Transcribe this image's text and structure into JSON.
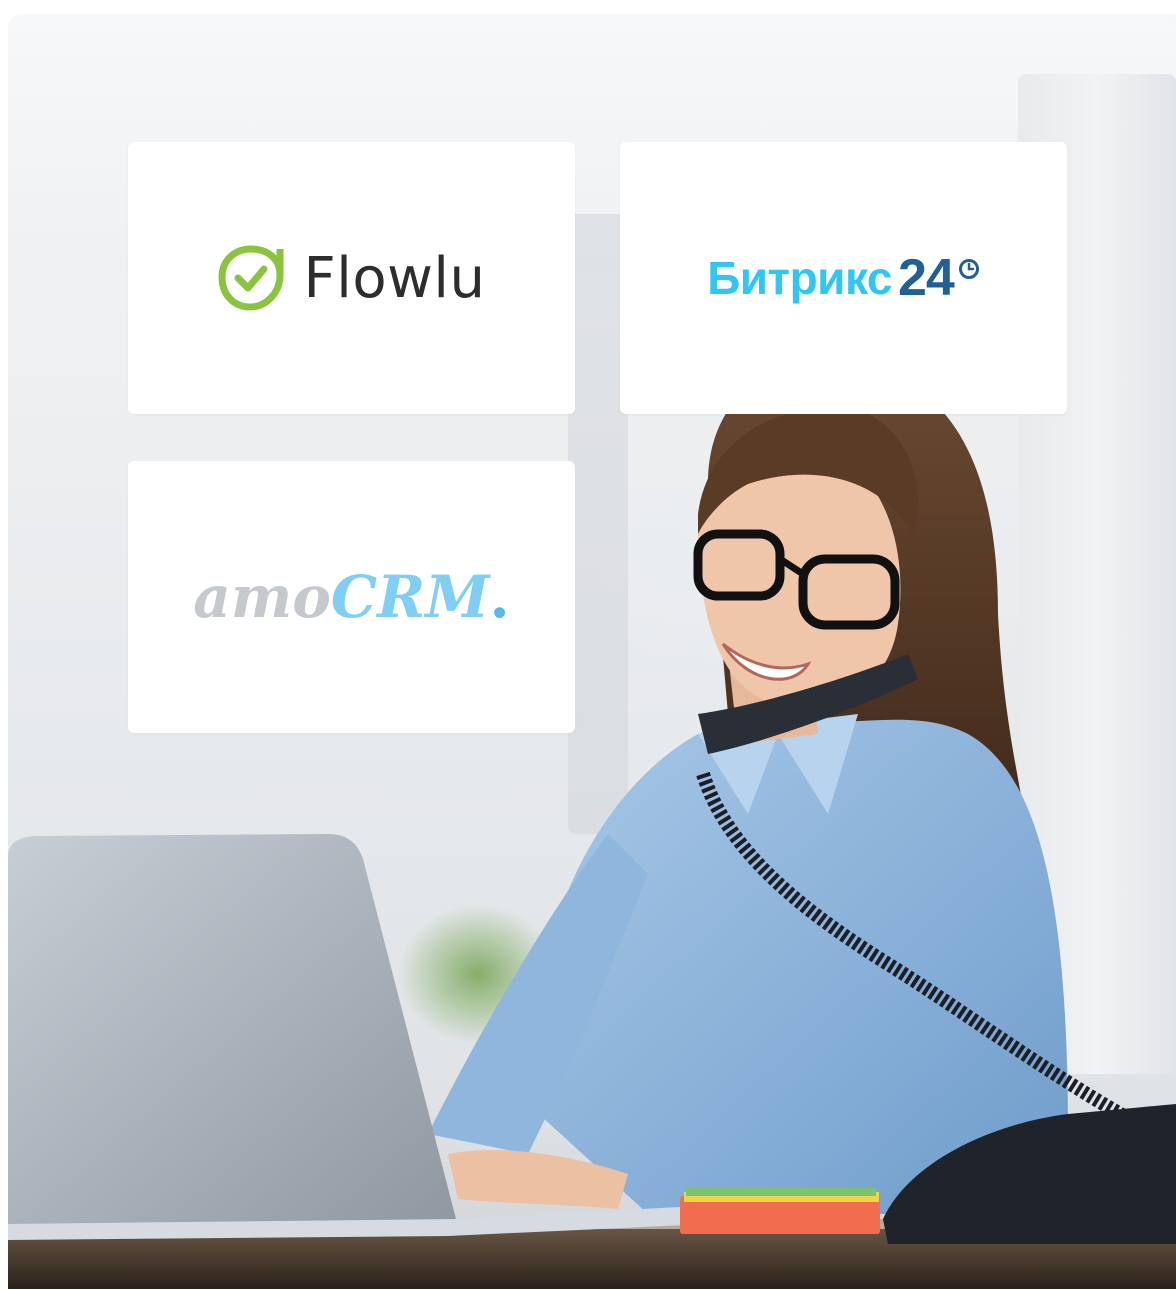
{
  "logos": {
    "flowlu": {
      "name": "Flowlu",
      "accent": "#8ac43f"
    },
    "bitrix": {
      "name": "Битрикс",
      "number": "24",
      "accent": "#2fc6f6",
      "number_color": "#215f98"
    },
    "amocrm": {
      "part1": "amo",
      "part2": "CRM",
      "dot": ".",
      "accent": "#7fcef3",
      "grey": "#c5c8cc"
    }
  },
  "scene": {
    "subject": "smiling woman in blue shirt and glasses talking on desk phone while typing on laptop",
    "shirt_color": "#8fb8dc",
    "hair_color": "#5a3b26"
  }
}
